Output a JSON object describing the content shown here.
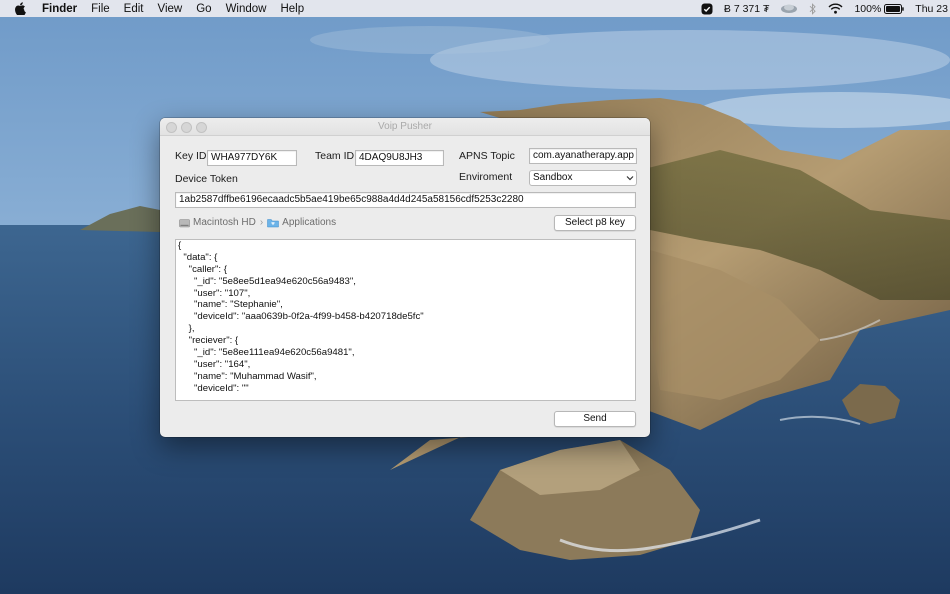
{
  "menubar": {
    "app_name": "Finder",
    "menus": [
      "File",
      "Edit",
      "View",
      "Go",
      "Window",
      "Help"
    ],
    "status": {
      "crypto_ticker": "Ƀ 7 371 ₮",
      "battery": "100%",
      "clock": "Thu 23"
    }
  },
  "window": {
    "title": "Voip Pusher",
    "key_id_label": "Key ID",
    "key_id_value": "WHA977DY6K",
    "team_id_label": "Team ID",
    "team_id_value": "4DAQ9U8JH3",
    "apns_topic_label": "APNS Topic",
    "apns_topic_value": "com.ayanatherapy.app",
    "device_token_label": "Device Token",
    "environment_label": "Enviroment",
    "environment_value": "Sandbox",
    "device_token_value": "1ab2587dffbe6196ecaadc5b5ae419be65c988a4d4d245a58156cdf5253c2280",
    "path": [
      "Macintosh HD",
      "Applications"
    ],
    "select_key_button": "Select p8 key",
    "payload_lines": [
      "{",
      "  \"data\": {",
      "    \"caller\": {",
      "      \"_id\": \"5e8ee5d1ea94e620c56a9483\",",
      "      \"user\": \"107\",",
      "      \"name\": \"Stephanie\",",
      "      \"deviceId\": \"aaa0639b-0f2a-4f99-b458-b420718de5fc\"",
      "    },",
      "    \"reciever\": {",
      "      \"_id\": \"5e8ee111ea94e620c56a9481\",",
      "      \"user\": \"164\",",
      "      \"name\": \"Muhammad Wasif\",",
      "      \"deviceId\": \"\""
    ],
    "send_button": "Send"
  }
}
